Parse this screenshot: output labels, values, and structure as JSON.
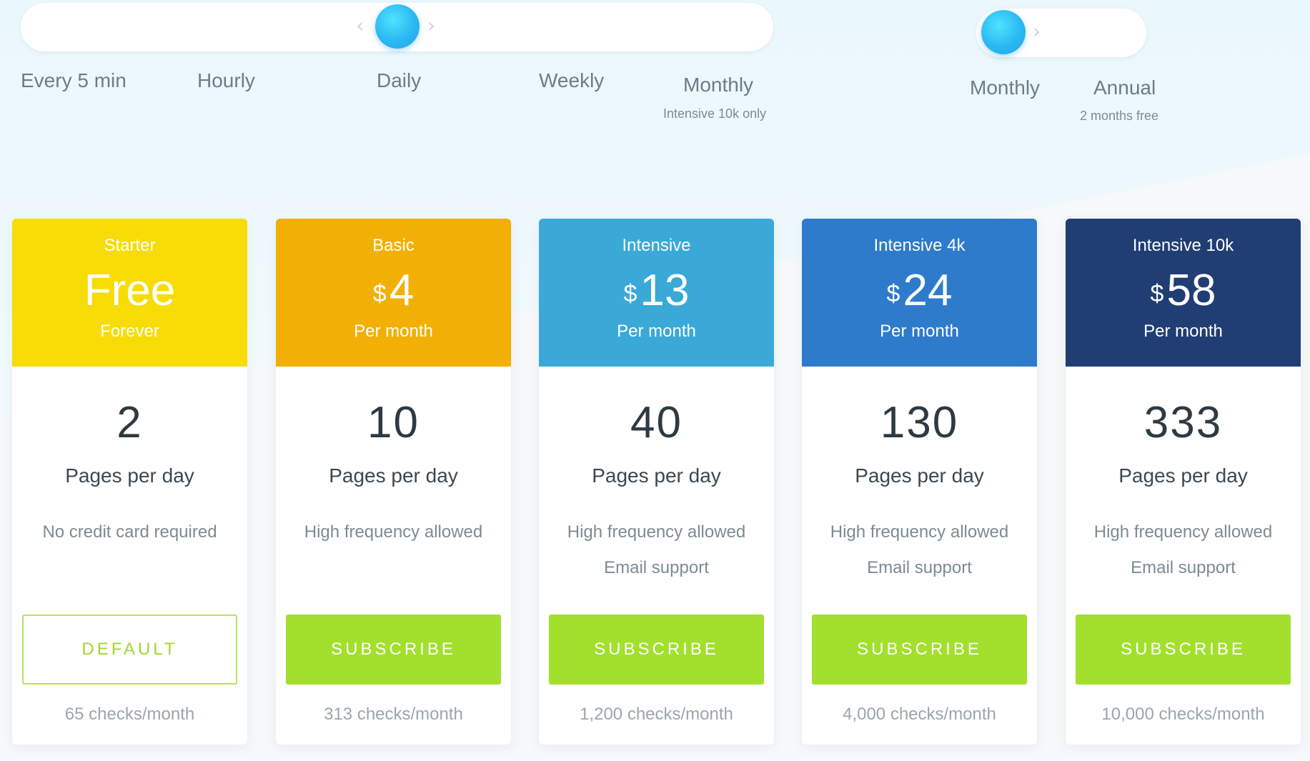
{
  "frequency": {
    "options": [
      {
        "label": "Every 5 min",
        "note": ""
      },
      {
        "label": "Hourly",
        "note": ""
      },
      {
        "label": "Daily",
        "note": ""
      },
      {
        "label": "Weekly",
        "note": ""
      },
      {
        "label": "Monthly",
        "note": "Intensive 10k only"
      }
    ],
    "selected": "Daily"
  },
  "billing": {
    "options": [
      {
        "label": "Monthly",
        "note": ""
      },
      {
        "label": "Annual",
        "note": "2 months free"
      }
    ],
    "selected": "Monthly"
  },
  "currency_symbol": "$",
  "plans": [
    {
      "name": "Starter",
      "price": "Free",
      "period": "Forever",
      "pages": "2",
      "pages_label": "Pages per day",
      "features": [
        "No credit card required"
      ],
      "button": "DEFAULT",
      "checks": "65 checks/month",
      "color": "#f7dc06"
    },
    {
      "name": "Basic",
      "price": "4",
      "period": "Per month",
      "pages": "10",
      "pages_label": "Pages per day",
      "features": [
        "High frequency allowed"
      ],
      "button": "SUBSCRIBE",
      "checks": "313 checks/month",
      "color": "#f2b006"
    },
    {
      "name": "Intensive",
      "price": "13",
      "period": "Per month",
      "pages": "40",
      "pages_label": "Pages per day",
      "features": [
        "High frequency allowed",
        "Email support"
      ],
      "button": "SUBSCRIBE",
      "checks": "1,200 checks/month",
      "color": "#3aa9d8"
    },
    {
      "name": "Intensive 4k",
      "price": "24",
      "period": "Per month",
      "pages": "130",
      "pages_label": "Pages per day",
      "features": [
        "High frequency allowed",
        "Email support"
      ],
      "button": "SUBSCRIBE",
      "checks": "4,000 checks/month",
      "color": "#2e7bcb"
    },
    {
      "name": "Intensive 10k",
      "price": "58",
      "period": "Per month",
      "pages": "333",
      "pages_label": "Pages per day",
      "features": [
        "High frequency allowed",
        "Email support"
      ],
      "button": "SUBSCRIBE",
      "checks": "10,000 checks/month",
      "color": "#213e74"
    }
  ],
  "colors": {
    "accent_button": "#a2e02d",
    "knob": "#2bb8f2"
  },
  "icons": {
    "prev": "chevron-left-icon",
    "next": "chevron-right-icon"
  }
}
